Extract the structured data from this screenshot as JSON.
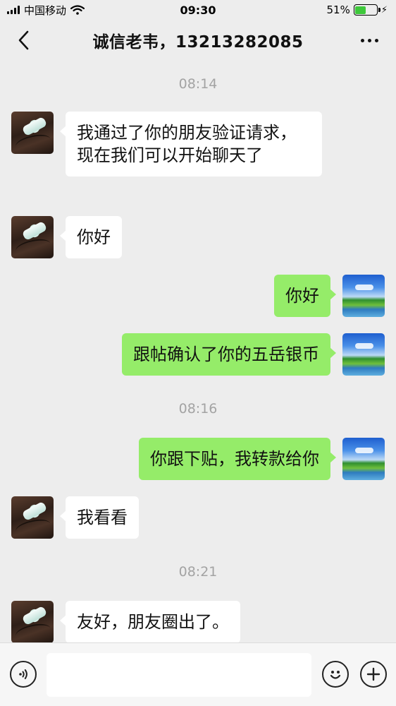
{
  "status_bar": {
    "carrier": "中国移动",
    "time": "09:30",
    "battery_percent": "51%",
    "battery_level": 0.51,
    "icons": [
      "signal-icon",
      "wifi-icon",
      "battery-icon",
      "charging-bolt-icon"
    ]
  },
  "nav": {
    "title": "诚信老韦，13213282085",
    "back_icon": "chevron-left-icon",
    "more_icon": "more-dots-icon"
  },
  "chat": {
    "timestamps": [
      "08:14",
      "08:16",
      "08:21"
    ],
    "messages": [
      {
        "side": "left",
        "text": "我通过了你的朋友验证请求，现在我们可以开始聊天了"
      },
      {
        "side": "left",
        "text": "你好"
      },
      {
        "side": "right",
        "text": "你好"
      },
      {
        "side": "right",
        "text": "跟帖确认了你的五岳银币"
      },
      {
        "side": "right",
        "text": "你跟下贴，我转款给你"
      },
      {
        "side": "left",
        "text": "我看看"
      },
      {
        "side": "left",
        "text": "友好，朋友圈出了。"
      }
    ]
  },
  "input_bar": {
    "voice_icon": "voice-icon",
    "emoji_icon": "emoji-icon",
    "plus_icon": "plus-icon",
    "text_value": ""
  },
  "colors": {
    "background": "#ededed",
    "bubble_outgoing": "#95ec69",
    "bubble_incoming": "#ffffff",
    "timestamp": "#a3a3a3",
    "battery_fill": "#3ec83b"
  }
}
